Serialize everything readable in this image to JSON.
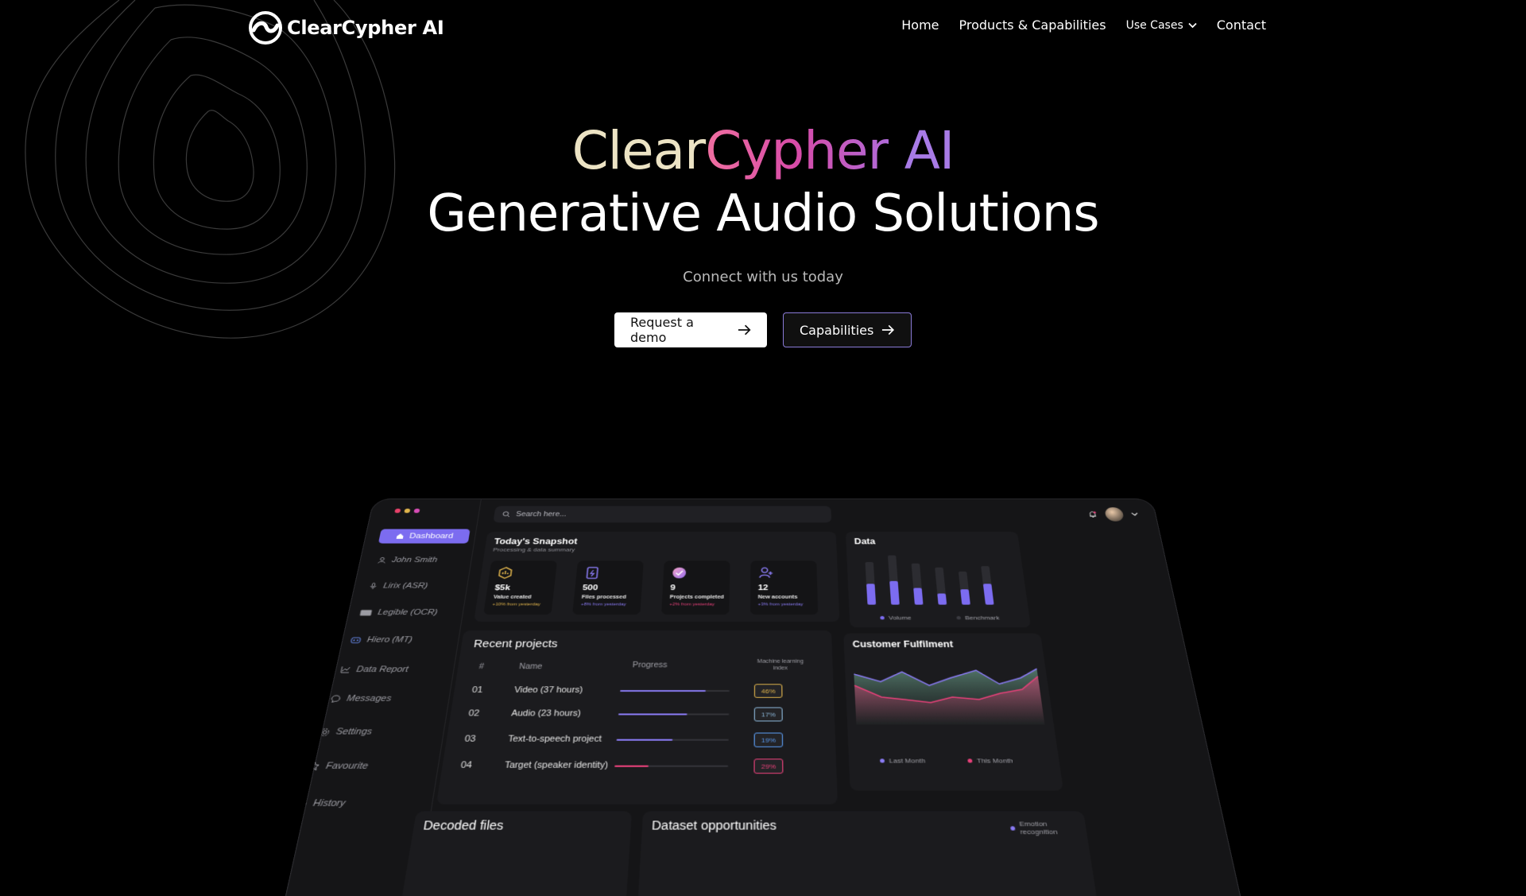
{
  "nav": {
    "logo_text": "ClearCypher AI",
    "links": [
      "Home",
      "Products & Capabilities"
    ],
    "use_cases": "Use Cases",
    "contact": "Contact"
  },
  "hero": {
    "brand_part1": "Clear",
    "brand_part2": "Cypher",
    "brand_part3": "AI",
    "title": "Generative Audio Solutions",
    "subtitle": "Connect with us today",
    "primary_cta": "Request a demo",
    "secondary_cta": "Capabilities"
  },
  "dashboard": {
    "search_placeholder": "Search here...",
    "sidebar": [
      {
        "label": "Dashboard",
        "icon": "home-icon"
      },
      {
        "label": "John Smith",
        "icon": "user-icon"
      },
      {
        "label": "Lirix (ASR)",
        "icon": "mic-icon"
      },
      {
        "label": "Legible (OCR)",
        "icon": "ocr-icon"
      },
      {
        "label": "Hiero (MT)",
        "icon": "translate-icon"
      },
      {
        "label": "Data Report",
        "icon": "chart-icon"
      },
      {
        "label": "Messages",
        "icon": "message-icon"
      },
      {
        "label": "Settings",
        "icon": "gear-icon"
      },
      {
        "label": "Favourite",
        "icon": "star-icon"
      },
      {
        "label": "History",
        "icon": "history-icon"
      }
    ],
    "snapshot": {
      "title": "Today's Snapshot",
      "subtitle": "Processing & data summary",
      "stats": [
        {
          "value": "$5k",
          "label": "Value created",
          "delta": "+10% from yesterday",
          "color": "#e0b44c"
        },
        {
          "value": "500",
          "label": "Files processed",
          "delta": "+8% from yesterday",
          "color": "#8b7cf6"
        },
        {
          "value": "9",
          "label": "Projects completed",
          "delta": "+2% from yesterday",
          "color": "#e8417a"
        },
        {
          "value": "12",
          "label": "New accounts",
          "delta": "+3% from yesterday",
          "color": "#8b7cf6"
        }
      ]
    },
    "data_card": {
      "title": "Data",
      "legend": [
        "Volume",
        "Benchmark"
      ]
    },
    "recent_projects": {
      "title": "Recent projects",
      "headers": [
        "#",
        "Name",
        "Progress",
        "Machine learning index"
      ],
      "rows": [
        {
          "num": "01",
          "name": "Video (37 hours)",
          "progress": 0.78,
          "badge": "46%",
          "color": "#8b7cf6",
          "badge_color": "#e0b44c"
        },
        {
          "num": "02",
          "name": "Audio (23 hours)",
          "progress": 0.62,
          "badge": "17%",
          "color": "#8b7cf6",
          "badge_color": "#8bb6d8"
        },
        {
          "num": "03",
          "name": "Text-to-speech project",
          "progress": 0.5,
          "badge": "19%",
          "color": "#8b7cf6",
          "badge_color": "#5a9bf0"
        },
        {
          "num": "04",
          "name": "Target (speaker identity)",
          "progress": 0.3,
          "badge": "29%",
          "color": "#e8417a",
          "badge_color": "#e8417a"
        }
      ]
    },
    "fulfilment": {
      "title": "Customer Fulfilment",
      "legend": [
        "Last Month",
        "This Month"
      ]
    },
    "decoded_files": "Decoded files",
    "dataset_opportunities": "Dataset opportunities",
    "emotion_recognition": "Emotion recognition",
    "colors": {
      "accent": "#7c6cf0",
      "pink": "#e8417a",
      "gold": "#e0b44c"
    }
  }
}
